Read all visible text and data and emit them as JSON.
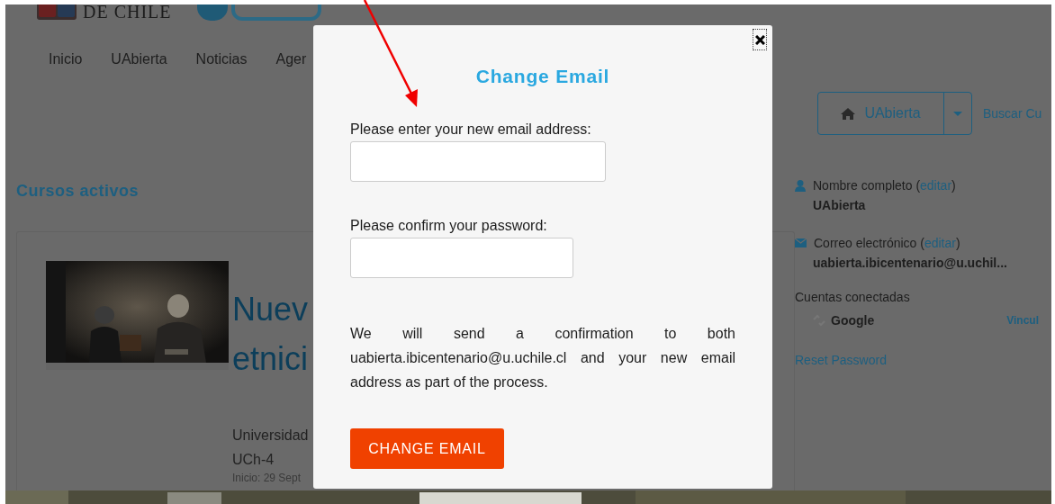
{
  "header": {
    "university": "DE CHILE"
  },
  "nav": [
    "Inicio",
    "UAbierta",
    "Noticias",
    "Ager"
  ],
  "courses": {
    "heading": "Cursos activos",
    "course": {
      "title_lines": [
        "Nuev",
        "etnici"
      ],
      "org": "Universidad",
      "code": "UCh-4",
      "start": "Inicio: 29 Sept"
    }
  },
  "site_menu": {
    "label": "UAbierta",
    "search_link": "Buscar Cu"
  },
  "profile": [
    {
      "kind": "name",
      "label": "Nombre completo (",
      "link": "editar",
      "after": ")",
      "value": "UAbierta"
    },
    {
      "kind": "email",
      "label": "Correo electrónico (",
      "link": "editar",
      "after": ")",
      "value": "uabierta.ibicentenario@u.uchil..."
    }
  ],
  "connected": {
    "heading": "Cuentas conectadas",
    "accounts": [
      {
        "name": "Google",
        "action": "Vincul"
      }
    ]
  },
  "reset_link": "Reset Password",
  "modal": {
    "title": "Change Email",
    "fields": [
      {
        "label": "Please enter your new email address:"
      },
      {
        "label": "Please confirm your password:"
      }
    ],
    "note": "We will send a confirmation to both uabierta.ibicentenario@u.uchile.cl and your new email address as part of the process.",
    "button": "CHANGE EMAIL"
  }
}
